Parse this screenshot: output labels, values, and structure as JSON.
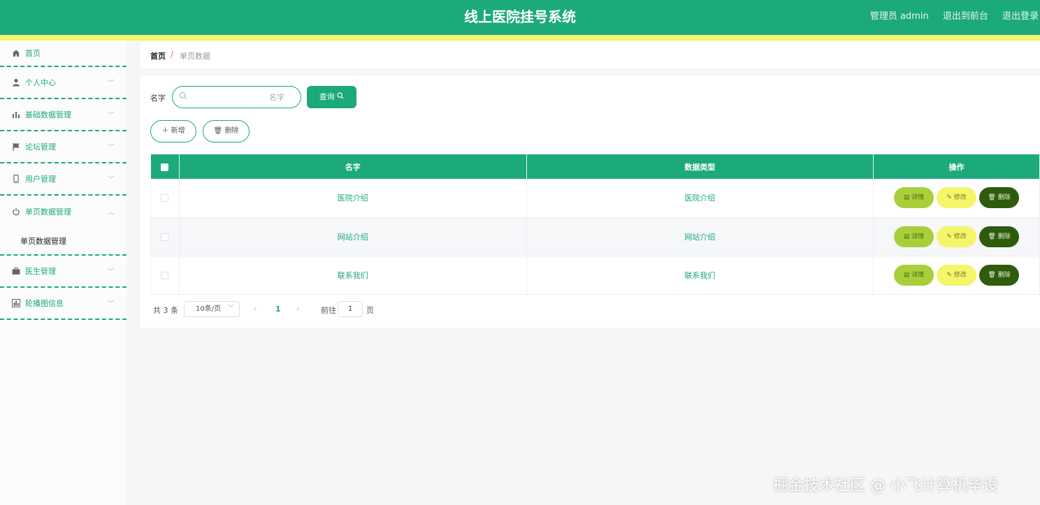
{
  "header": {
    "title": "线上医院挂号系统",
    "user": "管理员 admin",
    "to_front": "退出到前台",
    "logout": "退出登录"
  },
  "sidebar": {
    "items": [
      {
        "label": "首页",
        "icon": "home-icon"
      },
      {
        "label": "个人中心",
        "icon": "user-icon"
      },
      {
        "label": "基础数据管理",
        "icon": "bar-chart-icon"
      },
      {
        "label": "论坛管理",
        "icon": "flag-icon"
      },
      {
        "label": "用户管理",
        "icon": "phone-icon"
      },
      {
        "label": "单页数据管理",
        "icon": "power-icon",
        "sub": "单页数据管理"
      },
      {
        "label": "医生管理",
        "icon": "briefcase-icon"
      },
      {
        "label": "轮播图信息",
        "icon": "chart-icon"
      }
    ]
  },
  "breadcrumb": {
    "home": "首页",
    "separator": "/",
    "current": "单页数据"
  },
  "search": {
    "label": "名字",
    "placeholder": "名字",
    "button": "查询"
  },
  "actions": {
    "add": "新增",
    "delete": "删除"
  },
  "table": {
    "headers": [
      "名字",
      "数据类型",
      "操作"
    ],
    "rows": [
      {
        "name": "医院介绍",
        "type": "医院介绍"
      },
      {
        "name": "网站介绍",
        "type": "网站介绍"
      },
      {
        "name": "联系我们",
        "type": "联系我们"
      }
    ],
    "row_actions": {
      "detail": "详情",
      "edit": "修改",
      "delete": "删除"
    }
  },
  "pagination": {
    "total": "共 3 条",
    "page_size": "10条/页",
    "current_page": "1",
    "goto_label": "前往",
    "goto_value": "1",
    "page_unit": "页"
  },
  "watermark": "掘金技术社区 @ 小飞计算机毕设",
  "colors": {
    "primary": "#1ca97c",
    "accent_yellow": "#f5f56a",
    "detail": "#a9cf3a",
    "delete": "#2e5b0c"
  }
}
